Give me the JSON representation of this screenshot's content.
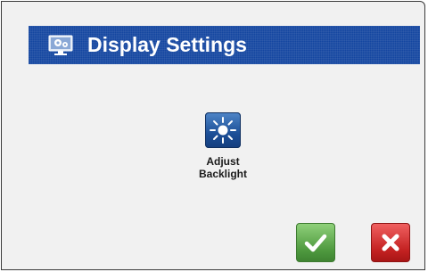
{
  "header": {
    "title": "Display Settings",
    "icon": "monitor-gears-icon"
  },
  "tiles": [
    {
      "label_line1": "Adjust",
      "label_line2": "Backlight",
      "icon": "sun-icon"
    }
  ],
  "actions": {
    "confirm_icon": "checkmark-icon",
    "cancel_icon": "x-icon",
    "confirm_color": "#4f9a3f",
    "cancel_color": "#c42222"
  },
  "colors": {
    "title_bar": "#1446a0",
    "background": "#f1f1f1"
  }
}
